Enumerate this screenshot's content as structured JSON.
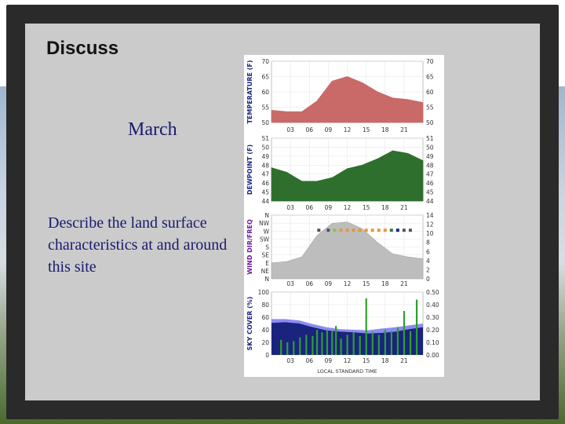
{
  "slide": {
    "title": "Discuss",
    "subtitle": "March",
    "body": "Describe the land surface characteristics at and around this site"
  },
  "chart_data": [
    {
      "type": "area",
      "ylabel": "TEMPERATURE (F)",
      "x_ticks": [
        "03",
        "06",
        "09",
        "12",
        "15",
        "18",
        "21"
      ],
      "yticks_left": [
        "70",
        "65",
        "60",
        "55",
        "50"
      ],
      "yticks_right": [
        "70",
        "65",
        "60",
        "55",
        "50"
      ],
      "ylim": [
        50,
        70
      ],
      "color": "#c96a68",
      "values": [
        54,
        53.5,
        53.5,
        57,
        63.5,
        65,
        63,
        60,
        58,
        57.5,
        56.5
      ]
    },
    {
      "type": "area",
      "ylabel": "DEWPOINT (F)",
      "x_ticks": [
        "03",
        "06",
        "09",
        "12",
        "15",
        "18",
        "21"
      ],
      "yticks_left": [
        "51",
        "50",
        "49",
        "48",
        "47",
        "46",
        "45",
        "44"
      ],
      "yticks_right": [
        "51",
        "50",
        "49",
        "48",
        "47",
        "46",
        "45",
        "44"
      ],
      "ylim": [
        44,
        51
      ],
      "color": "#2f6f2e",
      "values": [
        47.7,
        47.2,
        46.2,
        46.2,
        46.6,
        47.6,
        48,
        48.7,
        49.6,
        49.3,
        48.5
      ]
    },
    {
      "type": "scatter",
      "ylabel": "WIND DIR/FREQ",
      "x_ticks": [
        "03",
        "06",
        "09",
        "12",
        "15",
        "18",
        "21"
      ],
      "yticks_left": [
        "N",
        "NW",
        "W",
        "SW",
        "S",
        "SE",
        "E",
        "NE",
        "N"
      ],
      "yticks_right": [
        "14",
        "12",
        "10",
        "8",
        "6",
        "4",
        "2",
        "0"
      ],
      "ylim": [
        0,
        14
      ],
      "area_color": "#bdbdbd",
      "speed": [
        3.5,
        3.8,
        4.8,
        9.5,
        12.2,
        12.5,
        11,
        8,
        5.5,
        4.8,
        4.4
      ],
      "dir_points": [
        {
          "hour": 7.5,
          "dir": "NW",
          "color": "#555555"
        },
        {
          "hour": 9,
          "dir": "NW",
          "color": "#555555"
        },
        {
          "hour": 10,
          "dir": "NW",
          "color": "#8bc34a"
        },
        {
          "hour": 11,
          "dir": "NW",
          "color": "#e8953a"
        },
        {
          "hour": 12,
          "dir": "NW",
          "color": "#e8953a"
        },
        {
          "hour": 13,
          "dir": "NW",
          "color": "#e8953a"
        },
        {
          "hour": 14,
          "dir": "NW",
          "color": "#e8953a"
        },
        {
          "hour": 15,
          "dir": "NW",
          "color": "#e8953a"
        },
        {
          "hour": 16,
          "dir": "NW",
          "color": "#e8953a"
        },
        {
          "hour": 17,
          "dir": "NW",
          "color": "#e8953a"
        },
        {
          "hour": 18,
          "dir": "NW",
          "color": "#e8953a"
        },
        {
          "hour": 19,
          "dir": "NW",
          "color": "#2e7d32"
        },
        {
          "hour": 20,
          "dir": "NW",
          "color": "#1a237e"
        },
        {
          "hour": 21,
          "dir": "NW",
          "color": "#555555"
        },
        {
          "hour": 22,
          "dir": "NW",
          "color": "#555555"
        }
      ]
    },
    {
      "type": "bar",
      "ylabel": "SKY COVER (%)",
      "xlabel": "LOCAL STANDARD TIME",
      "x_ticks": [
        "03",
        "06",
        "09",
        "12",
        "15",
        "18",
        "21"
      ],
      "yticks_left": [
        "100",
        "80",
        "60",
        "40",
        "20",
        "0"
      ],
      "yticks_right": [
        "0.50",
        "0.40",
        "0.30",
        "0.20",
        "0.10",
        "0.00"
      ],
      "ylim": [
        0,
        100
      ],
      "cover_color": "#1a237e",
      "cover_light_color": "#8c8cf0",
      "bar_color": "#2e9e2e",
      "cover": [
        51,
        52,
        50,
        44,
        39,
        37,
        36,
        34,
        35,
        37,
        41,
        44
      ],
      "cover_upper": [
        57,
        57,
        55,
        49,
        44,
        41,
        40,
        39,
        42,
        44,
        47,
        50
      ],
      "precip": [
        {
          "hour": 1.5,
          "value": 0.12
        },
        {
          "hour": 2.5,
          "value": 0.1
        },
        {
          "hour": 3.5,
          "value": 0.11
        },
        {
          "hour": 4.5,
          "value": 0.14
        },
        {
          "hour": 5.5,
          "value": 0.16
        },
        {
          "hour": 6.5,
          "value": 0.15
        },
        {
          "hour": 7.2,
          "value": 0.2
        },
        {
          "hour": 8,
          "value": 0.18
        },
        {
          "hour": 8.8,
          "value": 0.2
        },
        {
          "hour": 9.6,
          "value": 0.19
        },
        {
          "hour": 10.2,
          "value": 0.23
        },
        {
          "hour": 11,
          "value": 0.13
        },
        {
          "hour": 12,
          "value": 0.16
        },
        {
          "hour": 13,
          "value": 0.18
        },
        {
          "hour": 14,
          "value": 0.15
        },
        {
          "hour": 15,
          "value": 0.45
        },
        {
          "hour": 16,
          "value": 0.18
        },
        {
          "hour": 17,
          "value": 0.16
        },
        {
          "hour": 18,
          "value": 0.2
        },
        {
          "hour": 19,
          "value": 0.19
        },
        {
          "hour": 20,
          "value": 0.22
        },
        {
          "hour": 21,
          "value": 0.35
        },
        {
          "hour": 22,
          "value": 0.19
        },
        {
          "hour": 23,
          "value": 0.44
        }
      ]
    }
  ]
}
